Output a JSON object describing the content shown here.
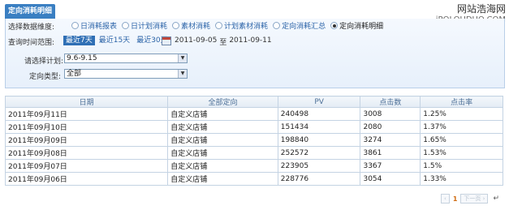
{
  "watermark": {
    "line1": "网站浩海网",
    "line2": "iPOLOUDUO.COM"
  },
  "tab": {
    "label": "定向消耗明细"
  },
  "filters": {
    "dimension_label": "选择数据维度:",
    "dimensions": [
      {
        "label": "日消耗报表",
        "selected": false
      },
      {
        "label": "日计划消耗",
        "selected": false
      },
      {
        "label": "素材消耗",
        "selected": false
      },
      {
        "label": "计划素材消耗",
        "selected": false
      },
      {
        "label": "定向消耗汇总",
        "selected": false
      },
      {
        "label": "定向消耗明细",
        "selected": true
      }
    ],
    "date_label": "查询时间范围:",
    "quick_ranges": [
      "最近7天",
      "最近15天",
      "最近30天"
    ],
    "quick_active": "最近7天",
    "date_from": "2011-09-05",
    "date_sep": "至",
    "date_to": "2011-09-11",
    "plan_label": "请选择计划:",
    "plan_value": "9.6-9.15",
    "target_label": "定向类型:",
    "target_value": "全部"
  },
  "table": {
    "headers": [
      "日期",
      "全部定向",
      "PV",
      "点击数",
      "点击率"
    ],
    "rows": [
      [
        "2011年09月11日",
        "自定义店铺",
        "240498",
        "3008",
        "1.25%"
      ],
      [
        "2011年09月10日",
        "自定义店铺",
        "151434",
        "2080",
        "1.37%"
      ],
      [
        "2011年09月09日",
        "自定义店铺",
        "198840",
        "3274",
        "1.65%"
      ],
      [
        "2011年09月08日",
        "自定义店铺",
        "252572",
        "3861",
        "1.53%"
      ],
      [
        "2011年09月07日",
        "自定义店铺",
        "223905",
        "3367",
        "1.5%"
      ],
      [
        "2011年09月06日",
        "自定义店铺",
        "228776",
        "3054",
        "1.33%"
      ]
    ]
  },
  "pager": {
    "prev": "‹",
    "current": "1",
    "next": "下一页 ›",
    "return_mark": "↵"
  },
  "colors": {
    "accent": "#3a7fc2",
    "link": "#2c64a8",
    "page_number": "#d06b11"
  }
}
